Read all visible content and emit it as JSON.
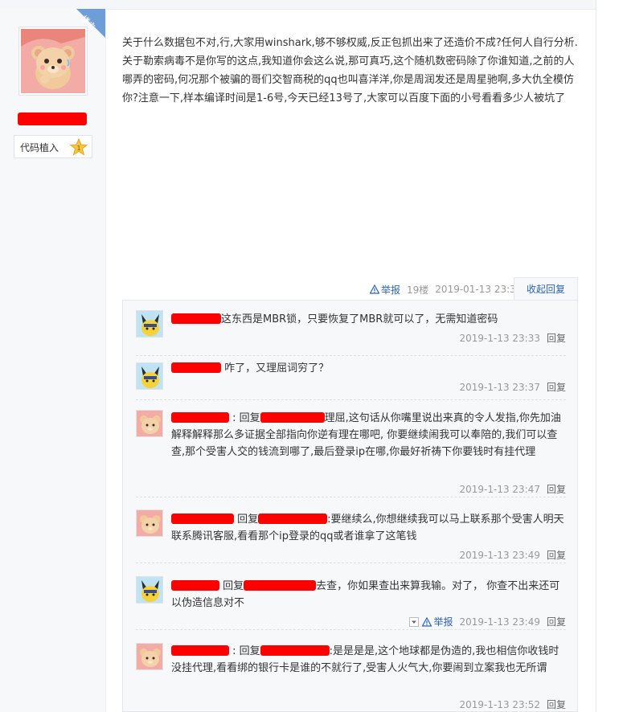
{
  "author": {
    "role_badge": "楼主",
    "level_label": "代码植入",
    "level_number": "1"
  },
  "post": {
    "paragraphs": [
      "关于什么数据包不对,行,大家用winshark,够不够权威,反正包抓出来了还造价不成?任何人自行分析.",
      "关于勒索病毒不是你写的这点,我知道你会这么说,那可真巧,这个随机数密码除了你谁知道,之前的人哪弄的密码,何况那个被骗的哥们交智商税的qq也叫喜洋洋,你是周润发还是周星驰啊,多大仇全模仿你?注意一下,样本编译时间是1-6号,今天已经13号了,大家可以百度下面的小号看看多少人被坑了"
    ],
    "report_label": "举报",
    "floor": "19楼",
    "time": "2019-01-13 23:30",
    "fold_label": "收起回复"
  },
  "replies": [
    {
      "text": "这东西是MBR锁，只要恢复了MBR就可以了，无需知道密码",
      "time": "2019-1-13 23:33",
      "action": "回复"
    },
    {
      "text": "咋了，又理屈词穷了？",
      "time": "2019-1-13 23:37",
      "action": "回复"
    },
    {
      "reply_word": "回复",
      "text": "理屈,这句话从你嘴里说出来真的令人发指,你先加油解释解释那么多证据全部指向你逆有理在哪吧, 你要继续闹我可以奉陪的,我们可以查查,那个受害人交的钱流到哪了,最后登录ip在哪,你最好祈祷下你要钱时有挂代理",
      "time": "2019-1-13 23:47",
      "action": "回复"
    },
    {
      "reply_word": "回复",
      "text": ":要继续么,你想继续我可以马上联系那个受害人明天联系腾讯客服,看看那个ip登录的qq或者谁拿了这笔钱",
      "time": "2019-1-13 23:49",
      "action": "回复"
    },
    {
      "reply_word": "回复",
      "text": "去查，你如果查出来算我输。对了， 你查不出来还可以伪造信息对不",
      "report": "举报",
      "time": "2019-1-13 23:49",
      "action": "回复"
    },
    {
      "reply_word": "回复",
      "text": ":是是是是,这个地球都是伪造的,我也相信你收钱时没挂代理,看看绑的银行卡是谁的不就行了,受害人火气大,你要闹到立案我也无所谓",
      "time": "2019-1-13 23:52",
      "action": "回复"
    }
  ],
  "icons": {
    "warning": "warning-icon",
    "star": "star-badge-icon",
    "collapse": "collapse-arrow-icon"
  },
  "colors": {
    "link": "#2d64b3",
    "redaction": "#ff0000",
    "ribbon": "#6e9ed8"
  }
}
